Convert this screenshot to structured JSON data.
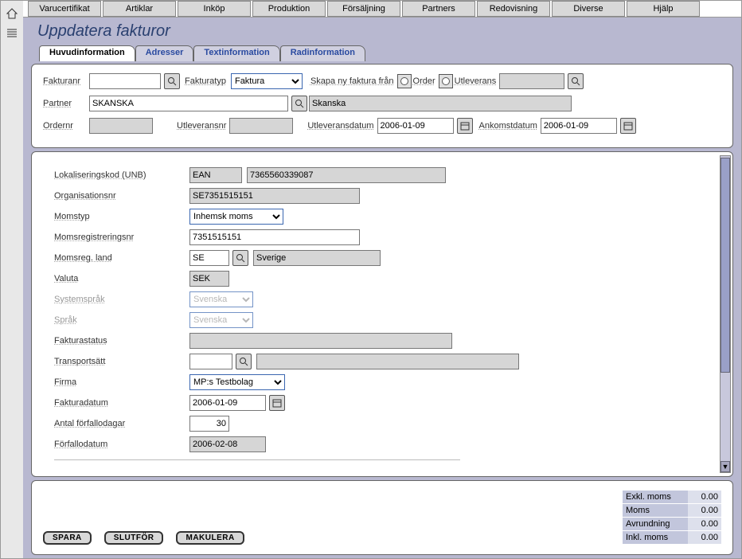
{
  "topTabs": [
    "Varucertifikat",
    "Artiklar",
    "Inköp",
    "Produktion",
    "Försäljning",
    "Partners",
    "Redovisning",
    "Diverse",
    "Hjälp"
  ],
  "pageTitle": "Uppdatera fakturor",
  "tabs": {
    "t0": "Huvudinformation",
    "t1": "Adresser",
    "t2": "Textinformation",
    "t3": "Radinformation"
  },
  "header": {
    "fakturanr_lbl": "Fakturanr",
    "fakturanr": "",
    "fakturatyp_lbl": "Fakturatyp",
    "fakturatyp": "Faktura",
    "skapa_lbl": "Skapa ny faktura från",
    "order_lbl": "Order",
    "utleverans_lbl": "Utleverans",
    "utlev_val": "",
    "partner_lbl": "Partner",
    "partner_code": "SKANSKA",
    "partner_name": "Skanska",
    "ordernr_lbl": "Ordernr",
    "ordernr": "",
    "utleveransnr_lbl": "Utleveransnr",
    "utleveransnr": "",
    "utlevdatum_lbl": "Utleveransdatum",
    "utlevdatum": "2006-01-09",
    "ankomst_lbl": "Ankomstdatum",
    "ankomst": "2006-01-09"
  },
  "form": {
    "lokal_lbl": "Lokaliseringskod (UNB)",
    "lokal_type": "EAN",
    "lokal_val": "7365560339087",
    "org_lbl": "Organisationsnr",
    "org_val": "SE7351515151",
    "momstyp_lbl": "Momstyp",
    "momstyp": "Inhemsk moms",
    "momsreg_lbl": "Momsregistreringsnr",
    "momsreg": "7351515151",
    "momsland_lbl": "Momsreg. land",
    "momsland_code": "SE",
    "momsland_name": "Sverige",
    "valuta_lbl": "Valuta",
    "valuta": "SEK",
    "sysspr_lbl": "Systemspråk",
    "sysspr": "Svenska",
    "sprak_lbl": "Språk",
    "sprak": "Svenska",
    "fstatus_lbl": "Fakturastatus",
    "fstatus": "",
    "trans_lbl": "Transportsätt",
    "trans_code": "",
    "trans_name": "",
    "firma_lbl": "Firma",
    "firma": "MP:s Testbolag",
    "fdatum_lbl": "Fakturadatum",
    "fdatum": "2006-01-09",
    "antal_lbl": "Antal förfallodagar",
    "antal": "30",
    "forfallo_lbl": "Förfallodatum",
    "forfallo": "2006-02-08"
  },
  "footer": {
    "spara": "SPARA",
    "slutfor": "SLUTFÖR",
    "makulera": "MAKULERA",
    "exkl_lbl": "Exkl. moms",
    "moms_lbl": "Moms",
    "avr_lbl": "Avrundning",
    "inkl_lbl": "Inkl. moms",
    "exkl": "0.00",
    "moms": "0.00",
    "avr": "0.00",
    "inkl": "0.00"
  }
}
